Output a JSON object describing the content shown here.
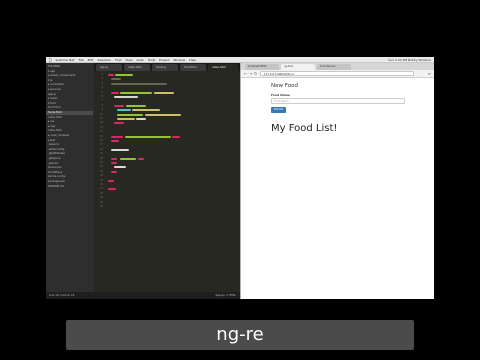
{
  "menubar": {
    "items": [
      "Sublime Text",
      "File",
      "Edit",
      "Selection",
      "Find",
      "View",
      "Goto",
      "Tools",
      "Project",
      "Window",
      "Help"
    ],
    "right": "Sun 1:22 PM  Bobby Williams"
  },
  "editor": {
    "tabs": [
      "app.js",
      "index.html",
      "foods.js",
      "food.html",
      "index.html"
    ],
    "active_tab_index": 4,
    "sidebar_items": [
      "FOLDERS",
      "▾ app",
      "  ▸ bower_components",
      "  ▾ js",
      "    ▸ controllers",
      "    ▸ services",
      "    app.js",
      "  ▾ views",
      "    ▾ food",
      "      food.html",
      "      foods.html",
      "    index.html",
      "  ▸ css",
      "  ▸ img",
      "  index.html",
      "▸ node_modules",
      "▸ test",
      ".bowerrc",
      ".editorconfig",
      ".gitattributes",
      ".gitignore",
      ".jshintrc",
      "bower.json",
      "Gruntfile.js",
      "karma.conf.js",
      "package.json",
      "README.md"
    ],
    "selected_sidebar_index": 10,
    "line_numbers": [
      "1",
      "2",
      "3",
      "4",
      "5",
      "6",
      "7",
      "8",
      "9",
      "10",
      "11",
      "12",
      "13",
      "14",
      "15",
      "16",
      "17",
      "18",
      "19",
      "20",
      "21",
      "22",
      "23",
      "24",
      "25",
      "26",
      "27",
      "28",
      "29",
      "30",
      "31"
    ],
    "status_left": "Line 19, Column 29",
    "status_right": "Spaces: 2   HTML"
  },
  "browser": {
    "tabs": [
      "Localhost:9000",
      "ng-food",
      "Food Service"
    ],
    "active_tab_index": 1,
    "url": "127.0.0.1:9000/#/food",
    "page": {
      "title": "New Food",
      "field_label": "Food Name",
      "field_placeholder": "Food Name",
      "submit_label": "Submit",
      "list_heading": "My Food List!"
    }
  },
  "caption": "ng-re",
  "colors": {
    "editor_bg": "#272822",
    "sidebar_bg": "#2e2e2e",
    "button_primary": "#337ab7",
    "caption_bg": "#4b4b4b"
  }
}
